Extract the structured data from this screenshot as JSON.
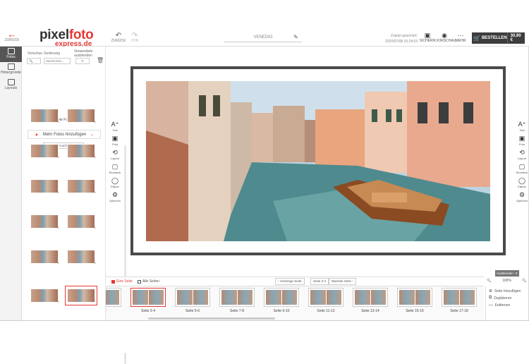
{
  "header": {
    "back_label": "ZURÜCK",
    "logo_main_a": "pixel",
    "logo_main_b": "foto",
    "logo_sub": "express.de",
    "undo_label": "ZURÜCK",
    "redo_label": "VOR",
    "project_title": "VENEDIG",
    "saved_caption": "Zuletzt gesichert:",
    "saved_time": "2020/07/08 15:24:53",
    "save_label": "SICHERN",
    "preview_label": "VORSCHAU",
    "more_label": "MEHR",
    "order_label": "BESTELLEN",
    "price": "30,90 €"
  },
  "rail": {
    "items": [
      {
        "label": "Fotos"
      },
      {
        "label": "Hintergründe"
      },
      {
        "label": "Layouts"
      }
    ]
  },
  "photos": {
    "preview_label": "Vorschau",
    "sort_label": "Sortierung",
    "hide_used_label": "Verwendete ausblenden",
    "sort_value": "Zuerst hinz...",
    "count_text": "14 verwendete Fotos/ 14 Fotos",
    "add_label": "Mehr Fotos hinzufügen",
    "autofill_label": "Autofill",
    "thumb_counts": [
      "1",
      "1",
      "1",
      "1",
      "1",
      "1",
      "1",
      "1",
      "1",
      "1",
      "1",
      "1",
      "1",
      "1"
    ]
  },
  "tools": {
    "items": [
      {
        "label": "Text"
      },
      {
        "label": "Foto"
      },
      {
        "label": "Layout"
      },
      {
        "label": "Rechteck"
      },
      {
        "label": "Ellipse"
      },
      {
        "label": "Optionen"
      }
    ]
  },
  "pages": {
    "single_label": "Eine Seite",
    "all_label": "Alle Seiten",
    "prev_label": "Vorherige Seite",
    "current_label": "Seite 3-4",
    "next_label": "Nächste Seite",
    "spreads": [
      "1-2",
      "Seite 3-4",
      "Seite 5-6",
      "Seite 7-8",
      "Seite 9-10",
      "Seite 11-12",
      "Seite 13-14",
      "Seite 15-16",
      "Seite 17-18"
    ]
  },
  "right": {
    "selected_label": "Ausblenden",
    "zoom": "100%",
    "add_page": "Seite hinzufügen",
    "duplicate": "Duplizieren",
    "remove": "Entfernen"
  },
  "colors": {
    "accent": "#e53935",
    "dark": "#3d3d3d"
  }
}
